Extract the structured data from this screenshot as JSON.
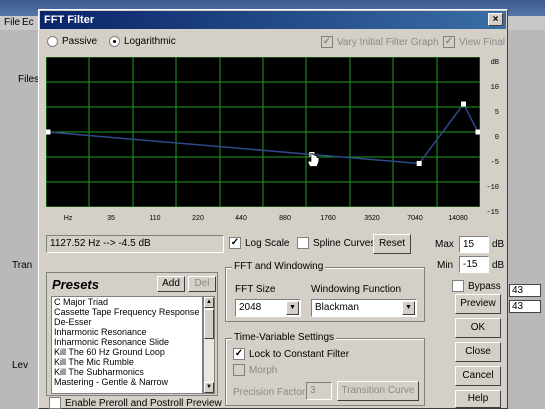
{
  "colors": {
    "title_bar": "#0a246a",
    "graph_bg": "#000000",
    "grid": "#1f9e1f",
    "curve": "#2d4a8a"
  },
  "dialog": {
    "title": "FFT Filter",
    "close_label": "×"
  },
  "mode": {
    "passive_label": "Passive",
    "logarithmic_label": "Logarithmic",
    "selected": "logarithmic",
    "vary_initial_label": "Vary Initial Filter Graph",
    "view_final_label": "View Final"
  },
  "graph": {
    "x_ticks": [
      "Hz",
      "35",
      "110",
      "220",
      "440",
      "880",
      "1760",
      "3520",
      "7040",
      "14080"
    ],
    "y_ticks": [
      "dB",
      "10",
      "5",
      "0",
      "-5",
      "-10",
      "-15"
    ],
    "control_points": [
      {
        "freq_hz": 10,
        "db": 0
      },
      {
        "freq_hz": 1127.52,
        "db": -4.5
      },
      {
        "freq_hz": 7700,
        "db": -6.3
      },
      {
        "freq_hz": 17000,
        "db": 5.6
      },
      {
        "freq_hz": 22050,
        "db": 0
      }
    ]
  },
  "readout": "1127.52 Hz --> -4.5 dB",
  "log_scale": {
    "label": "Log Scale",
    "checked": true
  },
  "spline_curves": {
    "label": "Spline Curves",
    "checked": false
  },
  "reset_label": "Reset",
  "max": {
    "label": "Max",
    "value": "15",
    "unit": "dB"
  },
  "min": {
    "label": "Min",
    "value": "-15",
    "unit": "dB"
  },
  "fft_group": {
    "title": "FFT and Windowing",
    "size_label": "FFT Size",
    "size_value": "2048",
    "window_label": "Windowing Function",
    "window_value": "Blackman"
  },
  "time_group": {
    "title": "Time-Variable Settings",
    "lock_label": "Lock to Constant Filter",
    "lock_checked": true,
    "morph_label": "Morph",
    "precision_label": "Precision Factor",
    "precision_value": "3",
    "transition_label": "Transition Curve"
  },
  "presets": {
    "title": "Presets",
    "add_label": "Add",
    "del_label": "Del",
    "items": [
      "C Major Triad",
      "Cassette Tape Frequency Response",
      "De-Esser",
      "Inharmonic Resonance",
      "Inharmonic Resonance Slide",
      "Kill The 60 Hz Ground Loop",
      "Kill The Mic Rumble",
      "Kill The Subharmonics",
      "Mastering - Gentle & Narrow"
    ],
    "preroll_label": "Enable Preroll and Postroll Preview"
  },
  "bypass": {
    "label": "Bypass",
    "checked": false
  },
  "buttons": {
    "preview": "Preview",
    "ok": "OK",
    "close": "Close",
    "cancel": "Cancel",
    "help": "Help"
  },
  "background": {
    "file_menu": "File",
    "edit_menu": "Ec",
    "files_label": "Files",
    "trans_label": "Tran",
    "level_label": "Lev",
    "vals": [
      "43",
      "43"
    ]
  }
}
